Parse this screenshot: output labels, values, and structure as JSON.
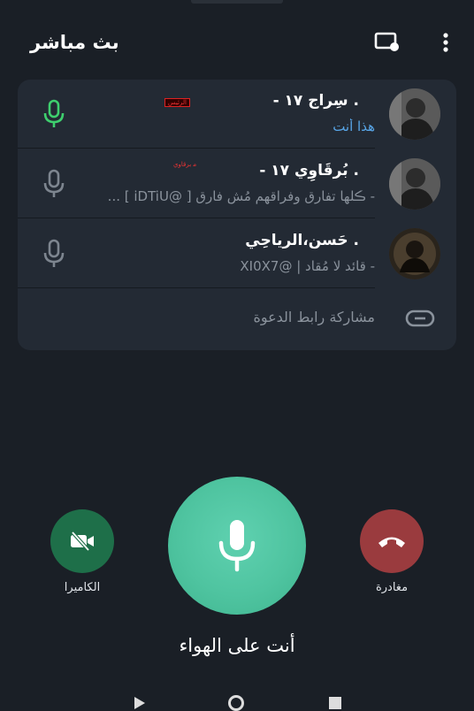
{
  "header": {
    "title": "بث مباشر",
    "screen_share_icon": "screen-share-icon",
    "menu_icon": "more-vert-icon"
  },
  "participants": [
    {
      "name": "- سِراج ١٧ .",
      "subtitle": "هذا أنت",
      "badge": "الرئيس",
      "mic_state": "active",
      "mic_color": "#3ecf6e"
    },
    {
      "name": "- بُرقَاوِي ١٧ .",
      "subtitle": "- ڪلها تفارق وفراقهم مُش فارق [ @iDTiU ] ...",
      "badge": "ﻣ ﺑﺮﻗﺎﻭﻱ",
      "mic_state": "idle",
      "mic_color": "#7d858f"
    },
    {
      "name": "حَسن،الرياحِي .",
      "subtitle": "- قائد لا مُقاد | @XI0X7",
      "badge": "",
      "mic_state": "idle",
      "mic_color": "#7d858f"
    }
  ],
  "invite": {
    "label": "مشاركة رابط الدعوة",
    "icon": "link-icon"
  },
  "controls": {
    "camera_label": "الكاميرا",
    "leave_label": "مغادرة",
    "status": "أنت على الهواء",
    "camera_color": "#1e6f49",
    "leave_color": "#9a3b3e",
    "mic_color": "#4fc4a0"
  }
}
